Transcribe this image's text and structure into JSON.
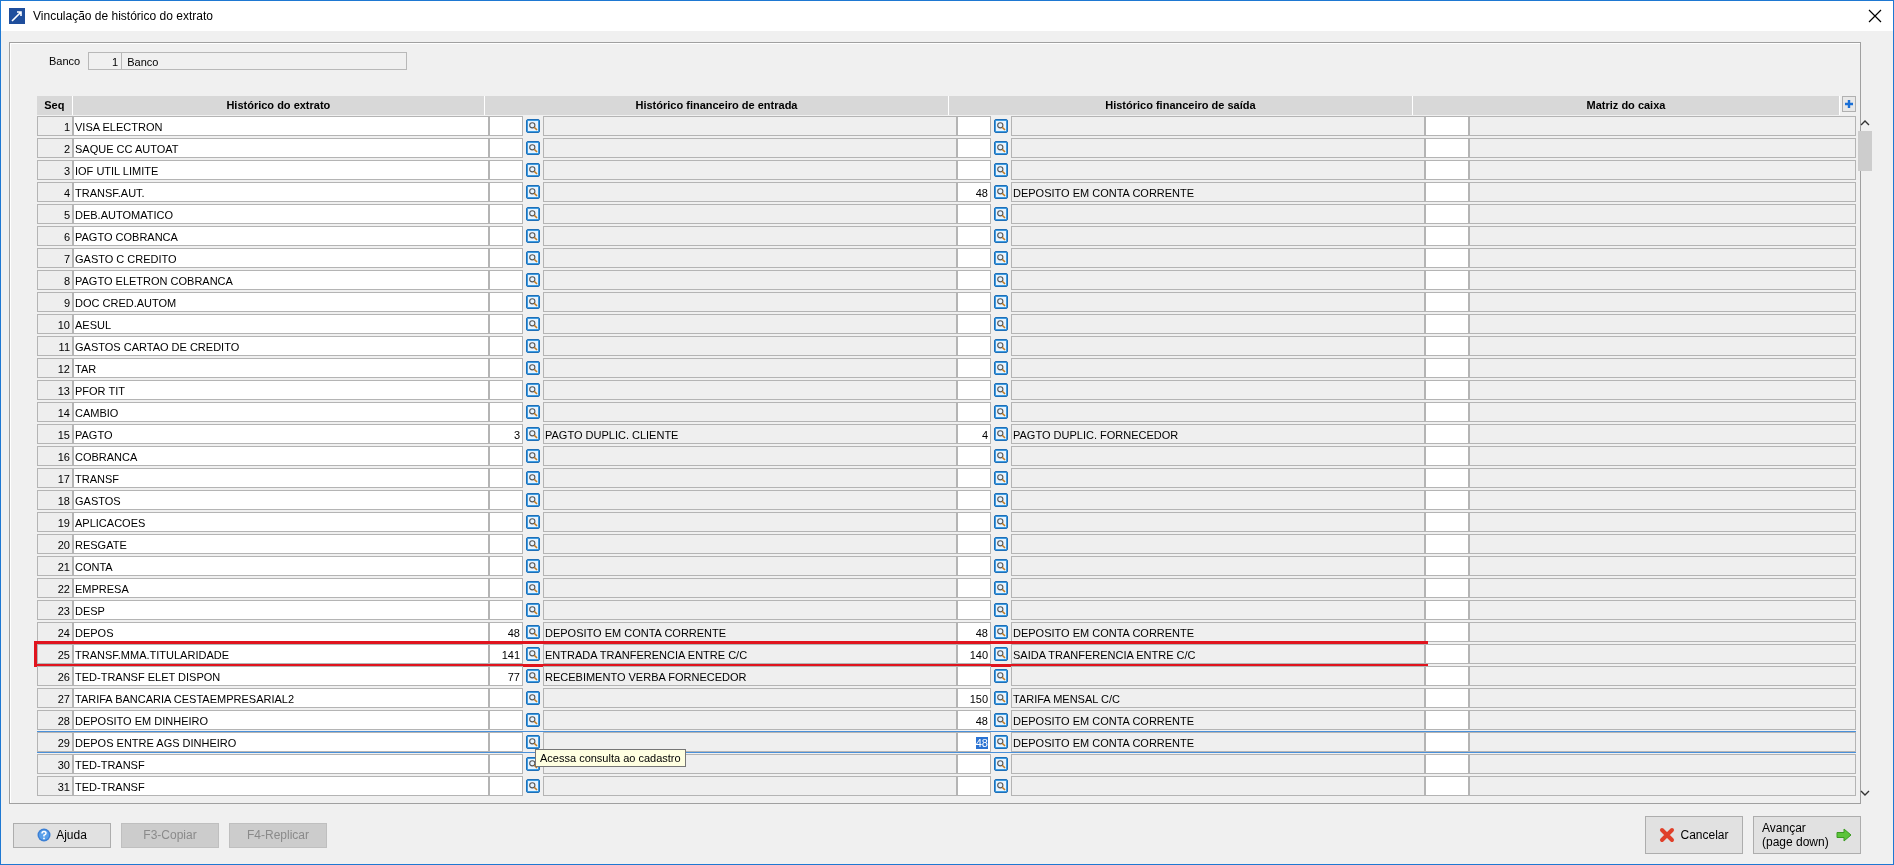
{
  "window": {
    "title": "Vinculação de histórico do extrato"
  },
  "banco": {
    "label": "Banco",
    "code": "1",
    "name": "Banco"
  },
  "table": {
    "columns": [
      "Seq",
      "Histórico do extrato",
      "Histórico financeiro de entrada",
      "Histórico financeiro de saída",
      "Matriz do caixa"
    ],
    "rows": [
      {
        "seq": "1",
        "extrato": "VISA ELECTRON",
        "entrada": {},
        "saida": {},
        "marked": false,
        "selected": false
      },
      {
        "seq": "2",
        "extrato": "SAQUE CC AUTOAT",
        "entrada": {},
        "saida": {},
        "marked": false,
        "selected": false
      },
      {
        "seq": "3",
        "extrato": "IOF UTIL LIMITE",
        "entrada": {},
        "saida": {},
        "marked": false,
        "selected": false
      },
      {
        "seq": "4",
        "extrato": "TRANSF.AUT.",
        "entrada": {},
        "saida": {
          "code": "48",
          "desc": "DEPOSITO EM CONTA CORRENTE"
        },
        "marked": false,
        "selected": false
      },
      {
        "seq": "5",
        "extrato": "DEB.AUTOMATICO",
        "entrada": {},
        "saida": {},
        "marked": false,
        "selected": false
      },
      {
        "seq": "6",
        "extrato": "PAGTO COBRANCA",
        "entrada": {},
        "saida": {},
        "marked": false,
        "selected": false
      },
      {
        "seq": "7",
        "extrato": "GASTO C CREDITO",
        "entrada": {},
        "saida": {},
        "marked": false,
        "selected": false
      },
      {
        "seq": "8",
        "extrato": "PAGTO ELETRON COBRANCA",
        "entrada": {},
        "saida": {},
        "marked": false,
        "selected": false
      },
      {
        "seq": "9",
        "extrato": "DOC CRED.AUTOM",
        "entrada": {},
        "saida": {},
        "marked": false,
        "selected": false
      },
      {
        "seq": "10",
        "extrato": "AESUL",
        "entrada": {},
        "saida": {},
        "marked": false,
        "selected": false
      },
      {
        "seq": "11",
        "extrato": "GASTOS CARTAO DE CREDITO",
        "entrada": {},
        "saida": {},
        "marked": false,
        "selected": false
      },
      {
        "seq": "12",
        "extrato": "TAR",
        "entrada": {},
        "saida": {},
        "marked": false,
        "selected": false
      },
      {
        "seq": "13",
        "extrato": "PFOR TIT",
        "entrada": {},
        "saida": {},
        "marked": false,
        "selected": false
      },
      {
        "seq": "14",
        "extrato": "CAMBIO",
        "entrada": {},
        "saida": {},
        "marked": false,
        "selected": false
      },
      {
        "seq": "15",
        "extrato": "PAGTO",
        "entrada": {
          "code": "3",
          "desc": "PAGTO DUPLIC. CLIENTE"
        },
        "saida": {
          "code": "4",
          "desc": "PAGTO DUPLIC. FORNECEDOR"
        },
        "marked": false,
        "selected": false
      },
      {
        "seq": "16",
        "extrato": "COBRANCA",
        "entrada": {},
        "saida": {},
        "marked": false,
        "selected": false
      },
      {
        "seq": "17",
        "extrato": "TRANSF",
        "entrada": {},
        "saida": {},
        "marked": false,
        "selected": false
      },
      {
        "seq": "18",
        "extrato": "GASTOS",
        "entrada": {},
        "saida": {},
        "marked": false,
        "selected": false
      },
      {
        "seq": "19",
        "extrato": "APLICACOES",
        "entrada": {},
        "saida": {},
        "marked": false,
        "selected": false
      },
      {
        "seq": "20",
        "extrato": "RESGATE",
        "entrada": {},
        "saida": {},
        "marked": false,
        "selected": false
      },
      {
        "seq": "21",
        "extrato": "CONTA",
        "entrada": {},
        "saida": {},
        "marked": false,
        "selected": false
      },
      {
        "seq": "22",
        "extrato": "EMPRESA",
        "entrada": {},
        "saida": {},
        "marked": false,
        "selected": false
      },
      {
        "seq": "23",
        "extrato": "DESP",
        "entrada": {},
        "saida": {},
        "marked": false,
        "selected": false
      },
      {
        "seq": "24",
        "extrato": "DEPOS",
        "entrada": {
          "code": "48",
          "desc": "DEPOSITO EM CONTA CORRENTE"
        },
        "saida": {
          "code": "48",
          "desc": "DEPOSITO EM CONTA CORRENTE"
        },
        "marked": false,
        "selected": false
      },
      {
        "seq": "25",
        "extrato": "TRANSF.MMA.TITULARIDADE",
        "entrada": {
          "code": "141",
          "desc": "ENTRADA TRANFERENCIA ENTRE C/C"
        },
        "saida": {
          "code": "140",
          "desc": "SAIDA TRANFERENCIA ENTRE C/C"
        },
        "marked": true,
        "selected": false
      },
      {
        "seq": "26",
        "extrato": "TED-TRANSF ELET DISPON",
        "entrada": {
          "code": "77",
          "desc": "RECEBIMENTO VERBA FORNECEDOR"
        },
        "saida": {},
        "marked": false,
        "selected": false
      },
      {
        "seq": "27",
        "extrato": "TARIFA BANCARIA CESTAEMPRESARIAL2",
        "entrada": {},
        "saida": {
          "code": "150",
          "desc": "TARIFA MENSAL C/C"
        },
        "marked": false,
        "selected": false
      },
      {
        "seq": "28",
        "extrato": "DEPOSITO EM DINHEIRO",
        "entrada": {},
        "saida": {
          "code": "48",
          "desc": "DEPOSITO EM CONTA CORRENTE"
        },
        "marked": false,
        "selected": false
      },
      {
        "seq": "29",
        "extrato": "DEPOS ENTRE AGS DINHEIRO",
        "entrada": {
          "tooltip": "Acessa consulta ao cadastro"
        },
        "saida": {
          "code": "48",
          "desc": "DEPOSITO EM CONTA CORRENTE"
        },
        "marked": false,
        "selected": true
      },
      {
        "seq": "30",
        "extrato": "TED-TRANSF",
        "entrada": {},
        "saida": {},
        "marked": false,
        "selected": false
      },
      {
        "seq": "31",
        "extrato": "TED-TRANSF",
        "entrada": {},
        "saida": {},
        "marked": false,
        "selected": false
      }
    ]
  },
  "buttons_left": [
    {
      "label": "Ajuda",
      "kind": "help",
      "disabled": false
    },
    {
      "label": "F3-Copiar",
      "kind": "plain",
      "disabled": true
    },
    {
      "label": "F4-Replicar",
      "kind": "plain",
      "disabled": true
    }
  ],
  "buttons_right": [
    {
      "label": "Cancelar",
      "kind": "cancel",
      "disabled": false
    },
    {
      "label": "Avançar\n(page down)",
      "kind": "next",
      "disabled": false
    }
  ]
}
